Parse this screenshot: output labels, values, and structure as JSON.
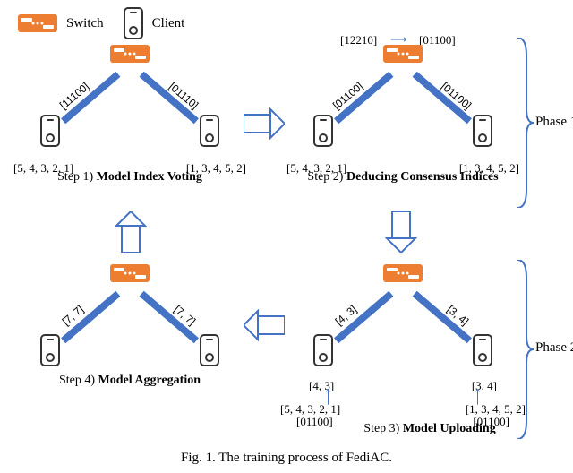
{
  "legend": {
    "switch": "Switch",
    "client": "Client"
  },
  "steps": {
    "s1": {
      "title": "Step 1)",
      "name": "Model Index Voting",
      "edgeLeft": "[11100]",
      "edgeRight": "[01110]",
      "clientLeft": "[5, 4, 3, 2, 1]",
      "clientRight": "[1, 3, 4, 5, 2]"
    },
    "s2": {
      "title": "Step 2)",
      "name": "Deducing Consensus Indices",
      "topA": "[12210]",
      "topB": "[01100]",
      "edgeLeft": "[01100]",
      "edgeRight": "[01100]",
      "clientLeft": "[5, 4, 3, 2, 1]",
      "clientRight": "[1, 3, 4, 5, 2]"
    },
    "s3": {
      "title": "Step 3)",
      "name": "Model Uploading",
      "edgeLeft": "[4, 3]",
      "edgeRight": "[3, 4]",
      "clientLeft": "[4, 3]",
      "clientRight": "[3, 4]",
      "srcLeft": "[5, 4, 3, 2, 1]",
      "maskLeft": "[01100]",
      "srcRight": "[1, 3, 4, 5, 2]",
      "maskRight": "[01100]"
    },
    "s4": {
      "title": "Step 4)",
      "name": "Model Aggregation",
      "edgeLeft": "[7, 7]",
      "edgeRight": "[7, 7]"
    }
  },
  "phases": {
    "p1": "Phase 1",
    "p2": "Phase 2"
  },
  "caption": "Fig. 1.   The training process of FediAC."
}
